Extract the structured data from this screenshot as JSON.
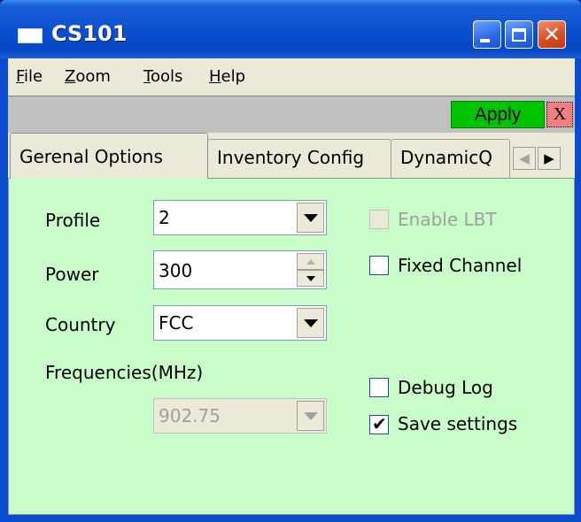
{
  "window": {
    "title": "CS101"
  },
  "menu": {
    "items": [
      {
        "label": "File",
        "underline": "F",
        "rest": "ile"
      },
      {
        "label": "Zoom",
        "underline": "Z",
        "rest": "oom"
      },
      {
        "label": "Tools",
        "underline": "T",
        "rest": "ools"
      },
      {
        "label": "Help",
        "underline": "H",
        "rest": "elp"
      }
    ]
  },
  "toolbar": {
    "apply_label": "Apply",
    "close_label": "X",
    "apply_color": "#00c400",
    "close_color": "#f08080"
  },
  "tabs": [
    {
      "label": "Gerenal Options",
      "active": true
    },
    {
      "label": "Inventory Config",
      "active": false
    },
    {
      "label": "DynamicQ",
      "active": false
    }
  ],
  "panel": {
    "background": "#c8fcc8",
    "profile": {
      "label": "Profile",
      "value": "2"
    },
    "power": {
      "label": "Power",
      "value": "300"
    },
    "country": {
      "label": "Country",
      "value": "FCC"
    },
    "frequencies": {
      "label": "Frequencies(MHz)",
      "value": "902.75"
    },
    "enable_lbt": {
      "label": "Enable LBT",
      "checked": false,
      "enabled": false
    },
    "fixed_channel": {
      "label": "Fixed Channel",
      "checked": false,
      "enabled": true
    },
    "debug_log": {
      "label": "Debug Log",
      "checked": false,
      "enabled": true
    },
    "save_settings": {
      "label": "Save settings",
      "checked": true,
      "enabled": true,
      "check_glyph": "✔"
    }
  }
}
